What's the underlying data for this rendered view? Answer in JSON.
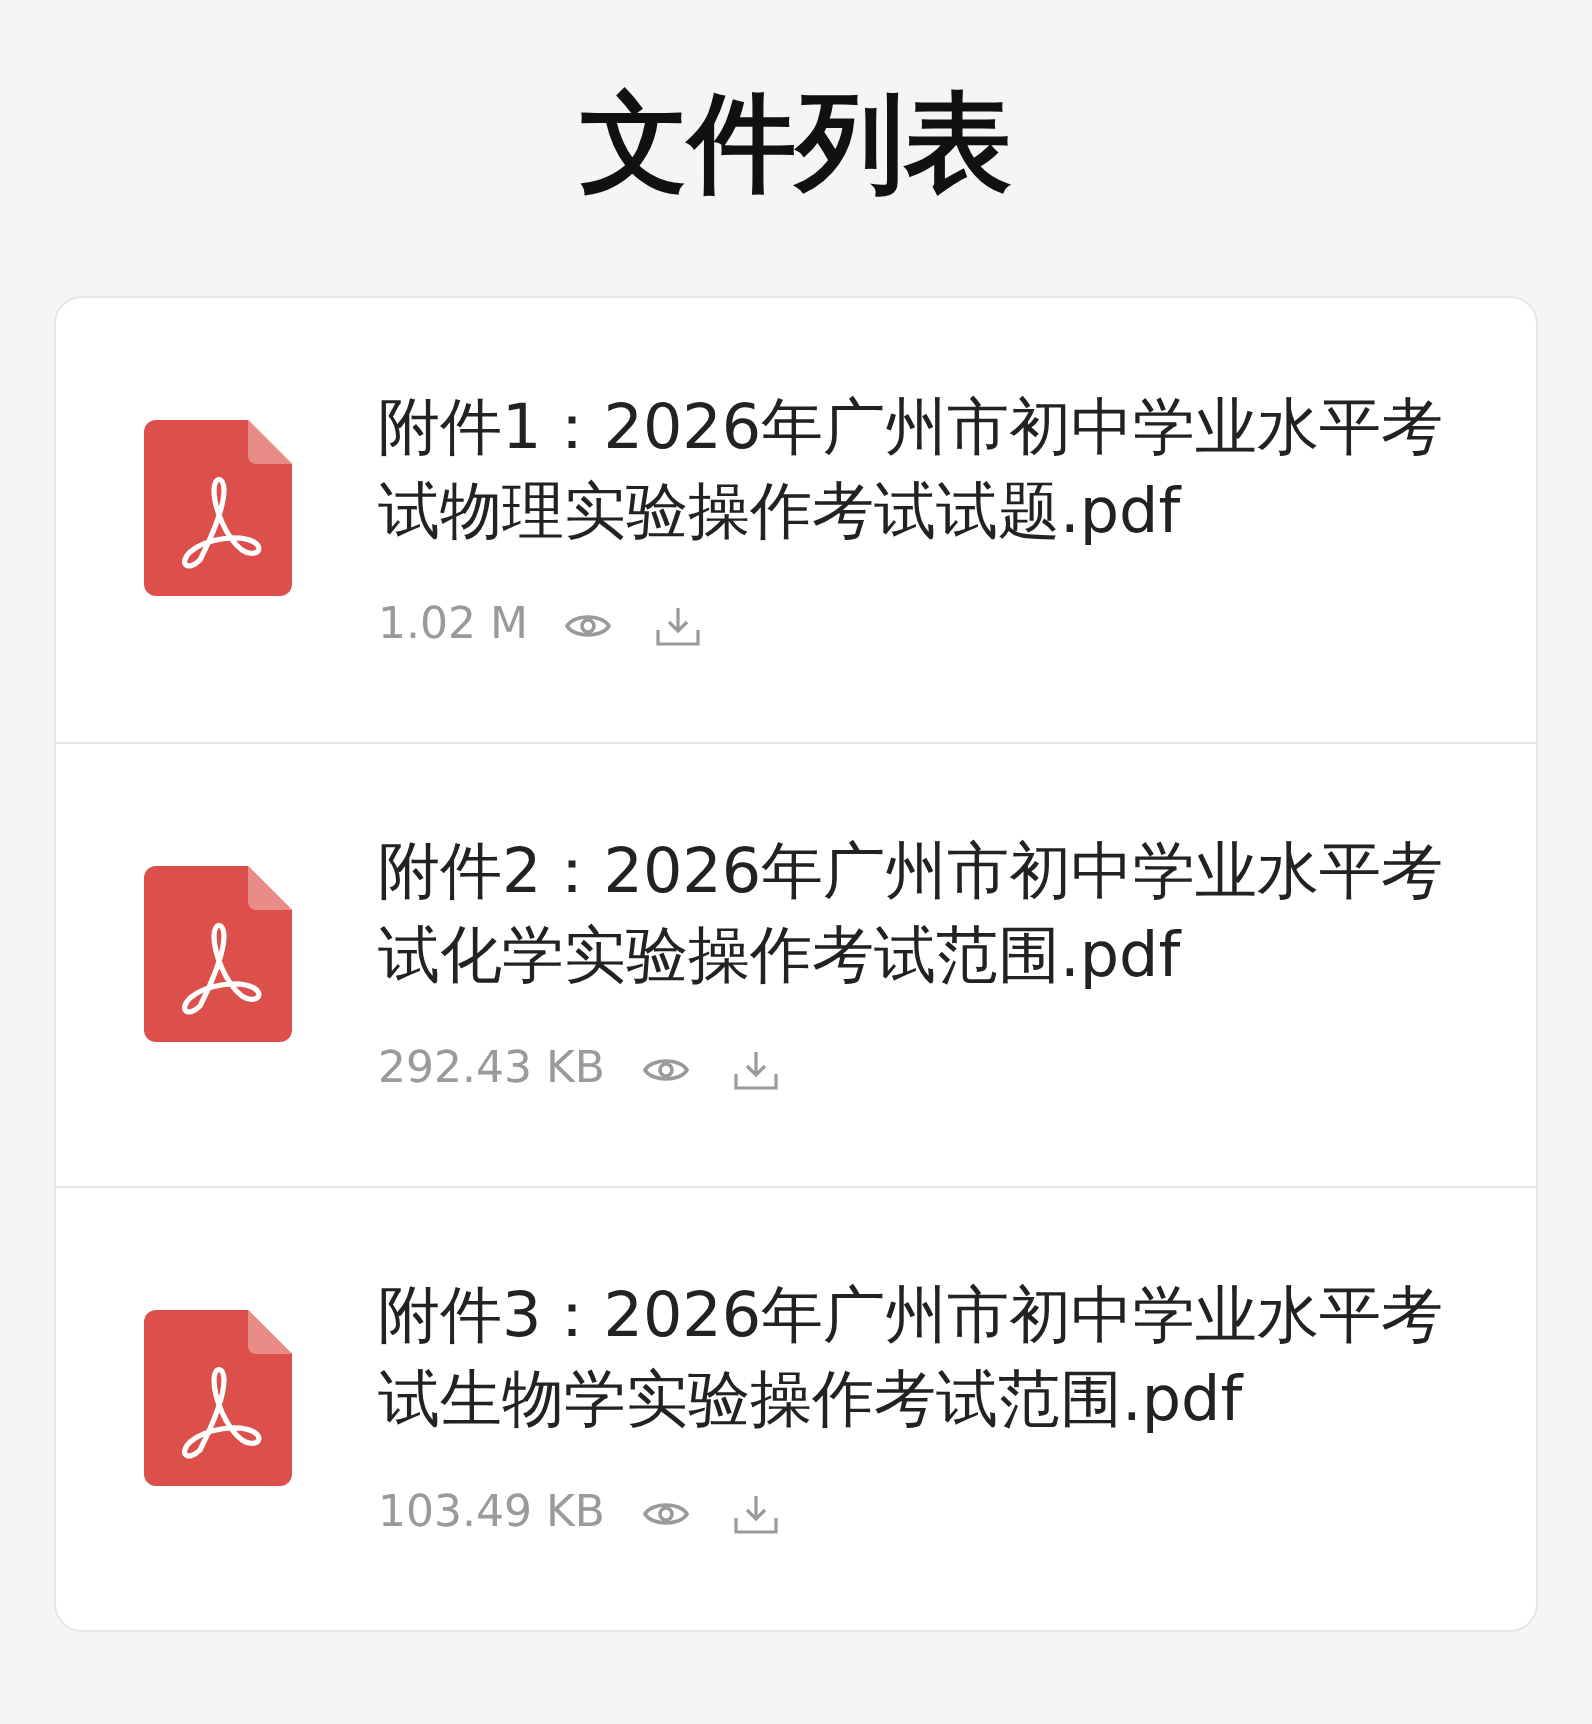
{
  "page": {
    "title": "文件列表"
  },
  "files": [
    {
      "name": "附件1：2026年广州市初中学业水平考试物理实验操作考试试题.pdf",
      "size": "1.02 M"
    },
    {
      "name": "附件2：2026年广州市初中学业水平考试化学实验操作考试范围.pdf",
      "size": "292.43 KB"
    },
    {
      "name": "附件3：2026年广州市初中学业水平考试生物学实验操作考试范围.pdf",
      "size": "103.49 KB"
    }
  ]
}
